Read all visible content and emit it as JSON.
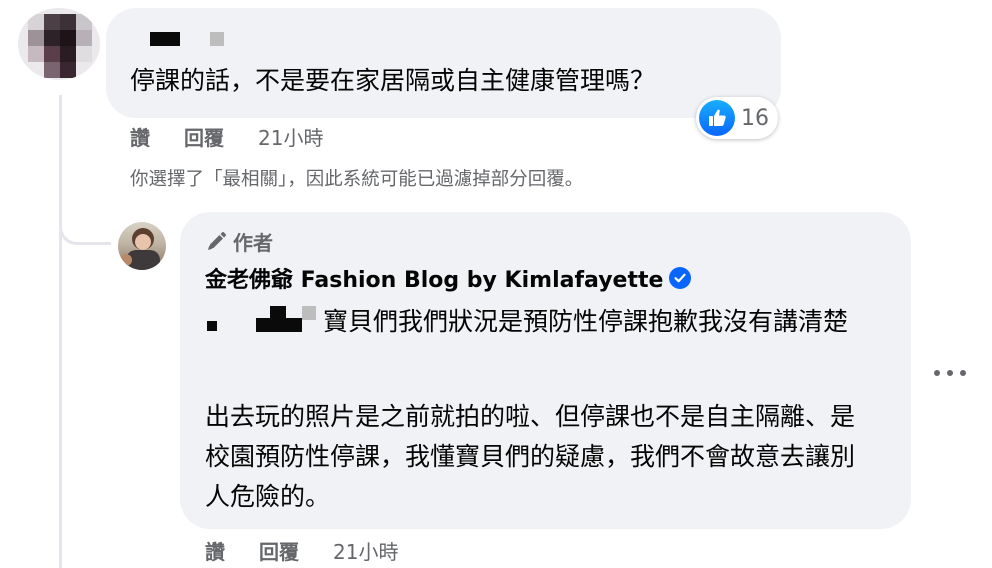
{
  "colors": {
    "bubble": "#f0f2f5",
    "meta_text": "#65676b",
    "like_blue": "#0866ff",
    "thread_line": "#e4e6eb"
  },
  "comment1": {
    "text": "停課的話，不是要在家居隔或自主健康管理嗎？",
    "reaction": {
      "icon": "like-icon",
      "count": "16"
    },
    "actions": {
      "like": "讚",
      "reply": "回覆",
      "time": "21小時"
    }
  },
  "filter_note": "你選擇了「最相關」，因此系統可能已過濾掉部分回覆。",
  "reply": {
    "badge_label": "作者",
    "badge_icon": "pencil-icon",
    "author_name": "金老佛爺 Fashion Blog by Kimlafayette",
    "verified_icon": "verified-badge-icon",
    "line1_text": "寶貝們我們狀況是預防性停課抱歉我沒有講清楚",
    "paragraph2": "出去玩的照片是之前就拍的啦、但停課也不是自主隔離、是校園預防性停課，我懂寶貝們的疑慮，我們不會故意去讓別人危險的。",
    "actions": {
      "like": "讚",
      "reply": "回覆",
      "time": "21小時"
    }
  },
  "more_icon": "more-options-icon"
}
